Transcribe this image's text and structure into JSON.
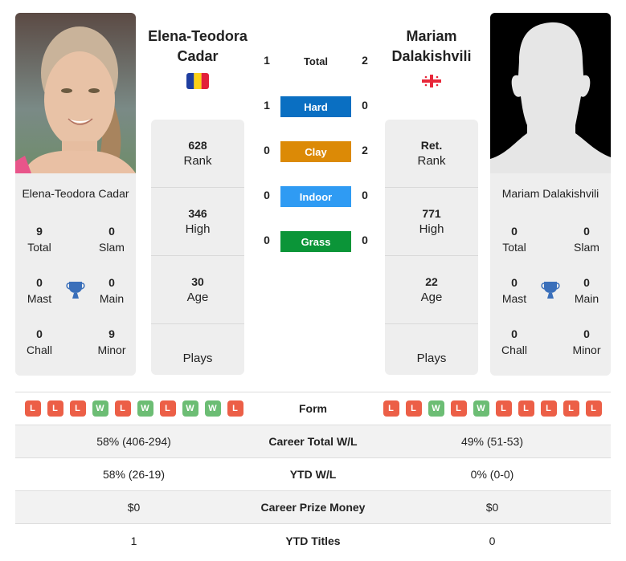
{
  "player1": {
    "name": "Elena-Teodora Cadar",
    "name_line1": "Elena-Teodora",
    "name_line2": "Cadar",
    "flag": "romania-flag",
    "card_name": "Elena-Teodora Cadar",
    "titles": {
      "total": {
        "value": "9",
        "label": "Total"
      },
      "slam": {
        "value": "0",
        "label": "Slam"
      },
      "mast": {
        "value": "0",
        "label": "Mast"
      },
      "main": {
        "value": "0",
        "label": "Main"
      },
      "chall": {
        "value": "0",
        "label": "Chall"
      },
      "minor": {
        "value": "9",
        "label": "Minor"
      }
    },
    "stats": [
      {
        "value": "628",
        "label": "Rank"
      },
      {
        "value": "346",
        "label": "High"
      },
      {
        "value": "30",
        "label": "Age"
      },
      {
        "value": "",
        "label": "Plays"
      }
    ],
    "form": [
      "L",
      "L",
      "L",
      "W",
      "L",
      "W",
      "L",
      "W",
      "W",
      "L"
    ]
  },
  "player2": {
    "name": "Mariam Dalakishvili",
    "name_line1": "Mariam",
    "name_line2": "Dalakishvili",
    "flag": "georgia-flag",
    "card_name": "Mariam Dalakishvili",
    "titles": {
      "total": {
        "value": "0",
        "label": "Total"
      },
      "slam": {
        "value": "0",
        "label": "Slam"
      },
      "mast": {
        "value": "0",
        "label": "Mast"
      },
      "main": {
        "value": "0",
        "label": "Main"
      },
      "chall": {
        "value": "0",
        "label": "Chall"
      },
      "minor": {
        "value": "0",
        "label": "Minor"
      }
    },
    "stats": [
      {
        "value": "Ret.",
        "label": "Rank"
      },
      {
        "value": "771",
        "label": "High"
      },
      {
        "value": "22",
        "label": "Age"
      },
      {
        "value": "",
        "label": "Plays"
      }
    ],
    "form": [
      "L",
      "L",
      "W",
      "L",
      "W",
      "L",
      "L",
      "L",
      "L",
      "L"
    ]
  },
  "h2h": {
    "total": {
      "label": "Total",
      "p1": "1",
      "p2": "2"
    },
    "surfaces": [
      {
        "label": "Hard",
        "p1": "1",
        "p2": "0",
        "color": "#0a6fc2"
      },
      {
        "label": "Clay",
        "p1": "0",
        "p2": "2",
        "color": "#dc8a06"
      },
      {
        "label": "Indoor",
        "p1": "0",
        "p2": "0",
        "color": "#2f9bf3"
      },
      {
        "label": "Grass",
        "p1": "0",
        "p2": "0",
        "color": "#0b9538"
      }
    ]
  },
  "colors": {
    "win": "#6cbd74",
    "loss": "#ec5f47",
    "trophy": "#3a6fba"
  },
  "table": {
    "form_label": "Form",
    "rows": [
      {
        "label": "Career Total W/L",
        "p1": "58% (406-294)",
        "p2": "49% (51-53)"
      },
      {
        "label": "YTD W/L",
        "p1": "58% (26-19)",
        "p2": "0% (0-0)"
      },
      {
        "label": "Career Prize Money",
        "p1": "$0",
        "p2": "$0"
      },
      {
        "label": "YTD Titles",
        "p1": "1",
        "p2": "0"
      }
    ]
  }
}
